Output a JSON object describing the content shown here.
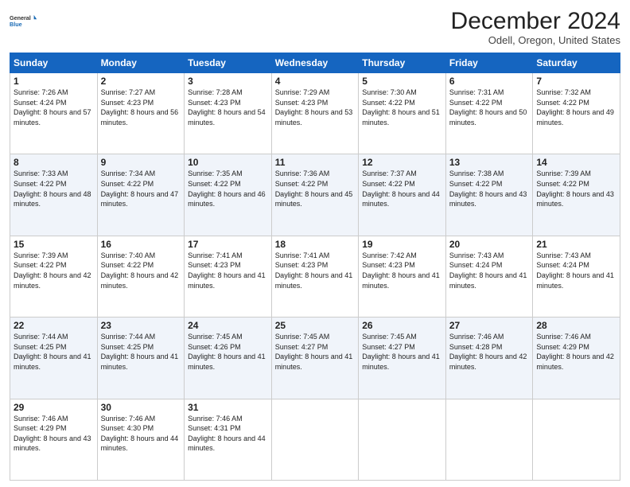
{
  "logo": {
    "general": "General",
    "blue": "Blue"
  },
  "header": {
    "month": "December 2024",
    "location": "Odell, Oregon, United States"
  },
  "weekdays": [
    "Sunday",
    "Monday",
    "Tuesday",
    "Wednesday",
    "Thursday",
    "Friday",
    "Saturday"
  ],
  "weeks": [
    [
      {
        "day": "1",
        "sunrise": "7:26 AM",
        "sunset": "4:24 PM",
        "daylight": "8 hours and 57 minutes."
      },
      {
        "day": "2",
        "sunrise": "7:27 AM",
        "sunset": "4:23 PM",
        "daylight": "8 hours and 56 minutes."
      },
      {
        "day": "3",
        "sunrise": "7:28 AM",
        "sunset": "4:23 PM",
        "daylight": "8 hours and 54 minutes."
      },
      {
        "day": "4",
        "sunrise": "7:29 AM",
        "sunset": "4:23 PM",
        "daylight": "8 hours and 53 minutes."
      },
      {
        "day": "5",
        "sunrise": "7:30 AM",
        "sunset": "4:22 PM",
        "daylight": "8 hours and 51 minutes."
      },
      {
        "day": "6",
        "sunrise": "7:31 AM",
        "sunset": "4:22 PM",
        "daylight": "8 hours and 50 minutes."
      },
      {
        "day": "7",
        "sunrise": "7:32 AM",
        "sunset": "4:22 PM",
        "daylight": "8 hours and 49 minutes."
      }
    ],
    [
      {
        "day": "8",
        "sunrise": "7:33 AM",
        "sunset": "4:22 PM",
        "daylight": "8 hours and 48 minutes."
      },
      {
        "day": "9",
        "sunrise": "7:34 AM",
        "sunset": "4:22 PM",
        "daylight": "8 hours and 47 minutes."
      },
      {
        "day": "10",
        "sunrise": "7:35 AM",
        "sunset": "4:22 PM",
        "daylight": "8 hours and 46 minutes."
      },
      {
        "day": "11",
        "sunrise": "7:36 AM",
        "sunset": "4:22 PM",
        "daylight": "8 hours and 45 minutes."
      },
      {
        "day": "12",
        "sunrise": "7:37 AM",
        "sunset": "4:22 PM",
        "daylight": "8 hours and 44 minutes."
      },
      {
        "day": "13",
        "sunrise": "7:38 AM",
        "sunset": "4:22 PM",
        "daylight": "8 hours and 43 minutes."
      },
      {
        "day": "14",
        "sunrise": "7:39 AM",
        "sunset": "4:22 PM",
        "daylight": "8 hours and 43 minutes."
      }
    ],
    [
      {
        "day": "15",
        "sunrise": "7:39 AM",
        "sunset": "4:22 PM",
        "daylight": "8 hours and 42 minutes."
      },
      {
        "day": "16",
        "sunrise": "7:40 AM",
        "sunset": "4:22 PM",
        "daylight": "8 hours and 42 minutes."
      },
      {
        "day": "17",
        "sunrise": "7:41 AM",
        "sunset": "4:23 PM",
        "daylight": "8 hours and 41 minutes."
      },
      {
        "day": "18",
        "sunrise": "7:41 AM",
        "sunset": "4:23 PM",
        "daylight": "8 hours and 41 minutes."
      },
      {
        "day": "19",
        "sunrise": "7:42 AM",
        "sunset": "4:23 PM",
        "daylight": "8 hours and 41 minutes."
      },
      {
        "day": "20",
        "sunrise": "7:43 AM",
        "sunset": "4:24 PM",
        "daylight": "8 hours and 41 minutes."
      },
      {
        "day": "21",
        "sunrise": "7:43 AM",
        "sunset": "4:24 PM",
        "daylight": "8 hours and 41 minutes."
      }
    ],
    [
      {
        "day": "22",
        "sunrise": "7:44 AM",
        "sunset": "4:25 PM",
        "daylight": "8 hours and 41 minutes."
      },
      {
        "day": "23",
        "sunrise": "7:44 AM",
        "sunset": "4:25 PM",
        "daylight": "8 hours and 41 minutes."
      },
      {
        "day": "24",
        "sunrise": "7:45 AM",
        "sunset": "4:26 PM",
        "daylight": "8 hours and 41 minutes."
      },
      {
        "day": "25",
        "sunrise": "7:45 AM",
        "sunset": "4:27 PM",
        "daylight": "8 hours and 41 minutes."
      },
      {
        "day": "26",
        "sunrise": "7:45 AM",
        "sunset": "4:27 PM",
        "daylight": "8 hours and 41 minutes."
      },
      {
        "day": "27",
        "sunrise": "7:46 AM",
        "sunset": "4:28 PM",
        "daylight": "8 hours and 42 minutes."
      },
      {
        "day": "28",
        "sunrise": "7:46 AM",
        "sunset": "4:29 PM",
        "daylight": "8 hours and 42 minutes."
      }
    ],
    [
      {
        "day": "29",
        "sunrise": "7:46 AM",
        "sunset": "4:29 PM",
        "daylight": "8 hours and 43 minutes."
      },
      {
        "day": "30",
        "sunrise": "7:46 AM",
        "sunset": "4:30 PM",
        "daylight": "8 hours and 44 minutes."
      },
      {
        "day": "31",
        "sunrise": "7:46 AM",
        "sunset": "4:31 PM",
        "daylight": "8 hours and 44 minutes."
      },
      null,
      null,
      null,
      null
    ]
  ]
}
